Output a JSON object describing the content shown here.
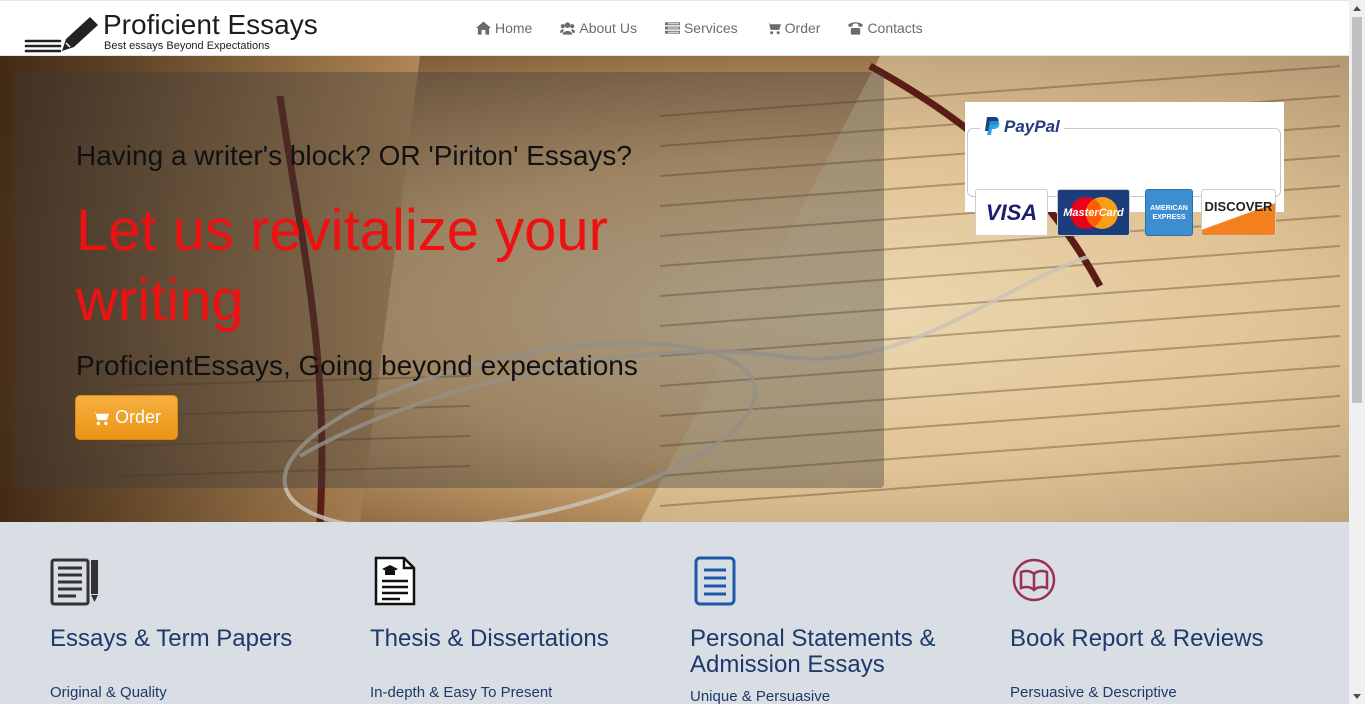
{
  "brand": {
    "name": "Proficient Essays",
    "tagline": "Best essays Beyond Expectations"
  },
  "nav": {
    "items": [
      {
        "label": "Home",
        "icon": "home-icon"
      },
      {
        "label": "About Us",
        "icon": "users-icon"
      },
      {
        "label": "Services",
        "icon": "list-icon"
      },
      {
        "label": "Order",
        "icon": "cart-icon"
      },
      {
        "label": "Contacts",
        "icon": "phone-icon"
      }
    ]
  },
  "hero": {
    "subheading": "Having a writer's block? OR 'Piriton' Essays?",
    "title": "Let us revitalize your writing",
    "tagline": "ProficientEssays, Going beyond expectations",
    "order_button": "Order",
    "title_color": "#ee1111",
    "button_color": "#f0a028"
  },
  "payments": {
    "paypal_label": "PayPal",
    "cards": [
      "VISA",
      "MasterCard",
      "AMERICAN EXPRESS",
      "DISCOVER"
    ]
  },
  "services": [
    {
      "title": "Essays & Term Papers",
      "desc": "Original & Quality",
      "icon": "document-pen-icon"
    },
    {
      "title": "Thesis & Dissertations",
      "desc": "In-depth & Easy To Present",
      "icon": "graduation-document-icon"
    },
    {
      "title": "Personal Statements & Admission Essays",
      "desc": "Unique & Persuasive",
      "icon": "file-text-icon"
    },
    {
      "title": "Book Report & Reviews",
      "desc": "Persuasive & Descriptive",
      "icon": "open-book-icon"
    }
  ]
}
